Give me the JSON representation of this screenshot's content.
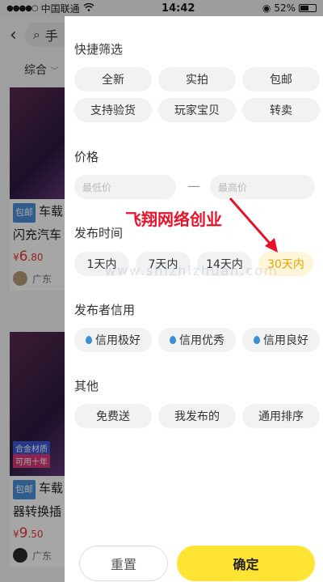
{
  "status_bar": {
    "carrier": "中国联通",
    "time": "14:42",
    "battery": "52%"
  },
  "background_page": {
    "search_text": "手",
    "sort_label": "综合",
    "items": [
      {
        "tag": "包邮",
        "title_line1": "车载",
        "title_line2": "闪充汽车",
        "price_symbol": "¥",
        "price_int": "6",
        "price_dec": ".80",
        "location": "广东"
      },
      {
        "tag": "包邮",
        "title_line1": "车载",
        "title_line2": "器转换插",
        "price_symbol": "¥",
        "price_int": "9",
        "price_dec": ".50",
        "location": "广东",
        "badge1": "合金材质",
        "badge2": "可用十年"
      }
    ]
  },
  "filter_panel": {
    "quick_filter": {
      "title": "快捷筛选",
      "chips": [
        "全新",
        "实拍",
        "包邮",
        "支持验货",
        "玩家宝贝",
        "转卖"
      ]
    },
    "price": {
      "title": "价格",
      "min_placeholder": "最低价",
      "separator": "—",
      "max_placeholder": "最高价"
    },
    "publish_time": {
      "title": "发布时间",
      "chips": [
        "1天内",
        "7天内",
        "14天内",
        "30天内"
      ],
      "selected": "30天内"
    },
    "credit": {
      "title": "发布者信用",
      "chips": [
        "信用极好",
        "信用优秀",
        "信用良好"
      ]
    },
    "other": {
      "title": "其他",
      "chips": [
        "免费送",
        "我发布的",
        "通用排序"
      ]
    },
    "reset_label": "重置",
    "confirm_label": "确定"
  },
  "overlay": {
    "promo_text": "飞翔网络创业",
    "watermark": "www.shizhizhuan.com"
  },
  "colors": {
    "accent_yellow": "#ffe433",
    "selected_text": "#e8a300",
    "price_red": "#e53935",
    "promo_red": "#e8132a"
  }
}
